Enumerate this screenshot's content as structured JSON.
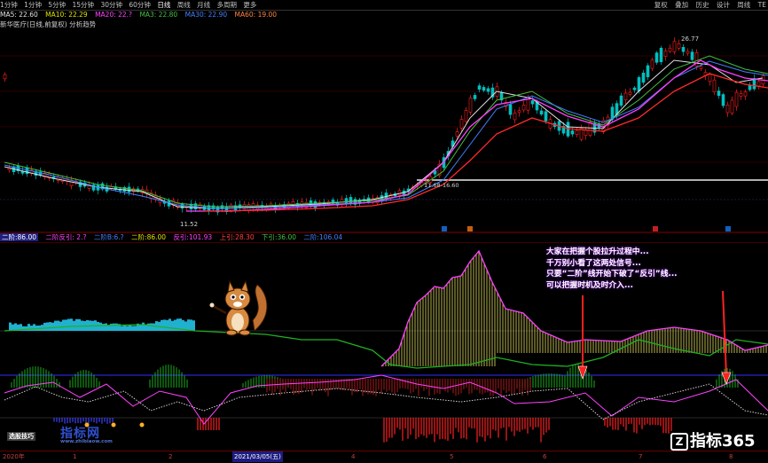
{
  "toolbar": {
    "periods": [
      "1分钟",
      "1分钟",
      "5分钟",
      "15分钟",
      "30分钟",
      "60分钟",
      "日线",
      "周线",
      "月线",
      "多周期",
      "更多"
    ],
    "right_tabs": [
      "复权",
      "叠加",
      "历史",
      "设计",
      "周线",
      "TE"
    ]
  },
  "main_legend": {
    "items": [
      "MA5: 22.60",
      "MA10: 22.29",
      "MA20: 22.?",
      "MA3: 22.80",
      "MA30: 22.90",
      "MA60: 19.00"
    ],
    "title": "新华医疗(日线,前复权)  分析趋势"
  },
  "price_labels": {
    "high": "26.77",
    "low": "11.52",
    "mid": "11.68-16.60"
  },
  "indicator_legend": {
    "items": [
      "二阶:86.00",
      "二阶反引: 2.?",
      "二阶B:6.?",
      "二阶:86.00",
      "反引:101.93",
      "上引:28.30",
      "下引:36.00",
      "二阶:106.04"
    ]
  },
  "callout": {
    "lines": [
      "大家在把握个股拉升过程中...",
      "千万别小看了这两处信号...",
      "只要“二阶”线开始下破了“反引”线...",
      "可以把握时机及时介入..."
    ]
  },
  "watermarks": {
    "left_brand": "指标网",
    "left_url": "www.zhibiaow.com",
    "left_badge": "选股技巧",
    "right_brand": "指标365"
  },
  "time_axis": {
    "labels": [
      "2020年",
      "1",
      "2",
      "2021/03/05(五)",
      "4",
      "5",
      "6",
      "7",
      "8"
    ],
    "highlight": "2021/03/05(五)"
  },
  "colors": {
    "up": "#ff2020",
    "down": "#00c0c0",
    "ma_white": "#e0e0e0",
    "ma_yellow": "#e0e000",
    "ma_magenta": "#ff40ff",
    "ma_green": "#40c040",
    "ma_red": "#ff2a2a",
    "bg": "#000000"
  }
}
